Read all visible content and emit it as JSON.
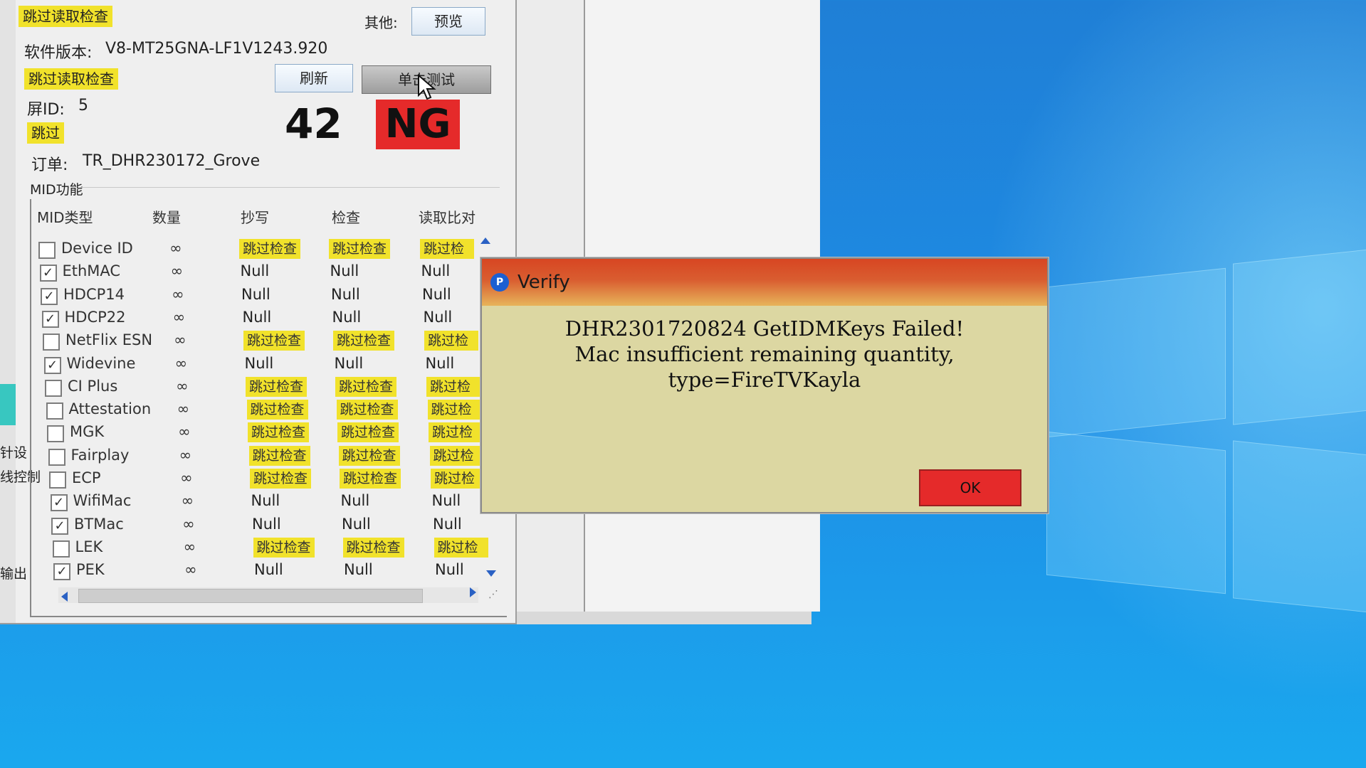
{
  "colors": {
    "skip_tag": "#f1e22b",
    "ng_red": "#e52a2a",
    "ok_red": "#e52a2a",
    "desktop_blue": "#1e8ee6",
    "dialog_bg": "#dcd7a2"
  },
  "app": {
    "top_skip_tag": "跳过读取检查",
    "other_label": "其他:",
    "preview_button": "预览",
    "software_version_label": "软件版本:",
    "software_version_value": "V8-MT25GNA-LF1V1243.920",
    "skip_read_tag": "跳过读取检查",
    "refresh_button": "刷新",
    "single_test_button": "单击测试",
    "screen_id_label": "屏ID:",
    "screen_id_value": "5",
    "skip_tag": "跳过",
    "count": "42",
    "result": "NG",
    "order_label": "订单:",
    "order_value": "TR_DHR230172_Grove",
    "left_side_labels": [
      "针设",
      "线控制",
      "输出"
    ]
  },
  "mid": {
    "section_title": "MID功能",
    "columns": [
      "MID类型",
      "数量",
      "抄写",
      "检查",
      "读取比对"
    ],
    "rows": [
      {
        "name": "Device ID",
        "checked": false,
        "qty": "∞",
        "write": "跳过检查",
        "check": "跳过检查",
        "read": "跳过检"
      },
      {
        "name": "EthMAC",
        "checked": true,
        "qty": "∞",
        "write": "Null",
        "check": "Null",
        "read": "Null"
      },
      {
        "name": "HDCP14",
        "checked": true,
        "qty": "∞",
        "write": "Null",
        "check": "Null",
        "read": "Null"
      },
      {
        "name": "HDCP22",
        "checked": true,
        "qty": "∞",
        "write": "Null",
        "check": "Null",
        "read": "Null"
      },
      {
        "name": "NetFlix ESN",
        "checked": false,
        "qty": "∞",
        "write": "跳过检查",
        "check": "跳过检查",
        "read": "跳过检"
      },
      {
        "name": "Widevine",
        "checked": true,
        "qty": "∞",
        "write": "Null",
        "check": "Null",
        "read": "Null"
      },
      {
        "name": "CI Plus",
        "checked": false,
        "qty": "∞",
        "write": "跳过检查",
        "check": "跳过检查",
        "read": "跳过检"
      },
      {
        "name": "Attestation",
        "checked": false,
        "qty": "∞",
        "write": "跳过检查",
        "check": "跳过检查",
        "read": "跳过检"
      },
      {
        "name": "MGK",
        "checked": false,
        "qty": "∞",
        "write": "跳过检查",
        "check": "跳过检查",
        "read": "跳过检"
      },
      {
        "name": "Fairplay",
        "checked": false,
        "qty": "∞",
        "write": "跳过检查",
        "check": "跳过检查",
        "read": "跳过检"
      },
      {
        "name": "ECP",
        "checked": false,
        "qty": "∞",
        "write": "跳过检查",
        "check": "跳过检查",
        "read": "跳过检"
      },
      {
        "name": "WifiMac",
        "checked": true,
        "qty": "∞",
        "write": "Null",
        "check": "Null",
        "read": "Null"
      },
      {
        "name": "BTMac",
        "checked": true,
        "qty": "∞",
        "write": "Null",
        "check": "Null",
        "read": "Null"
      },
      {
        "name": "LEK",
        "checked": false,
        "qty": "∞",
        "write": "跳过检查",
        "check": "跳过检查",
        "read": "跳过检"
      },
      {
        "name": "PEK",
        "checked": true,
        "qty": "∞",
        "write": "Null",
        "check": "Null",
        "read": "Null"
      }
    ]
  },
  "dialog": {
    "icon_letter": "P",
    "title": "Verify",
    "message_line1": "DHR2301720824 GetIDMKeys Failed!",
    "message_line2": "Mac insufficient remaining quantity,",
    "message_line3": "type=FireTVKayla",
    "ok_button": "OK"
  }
}
